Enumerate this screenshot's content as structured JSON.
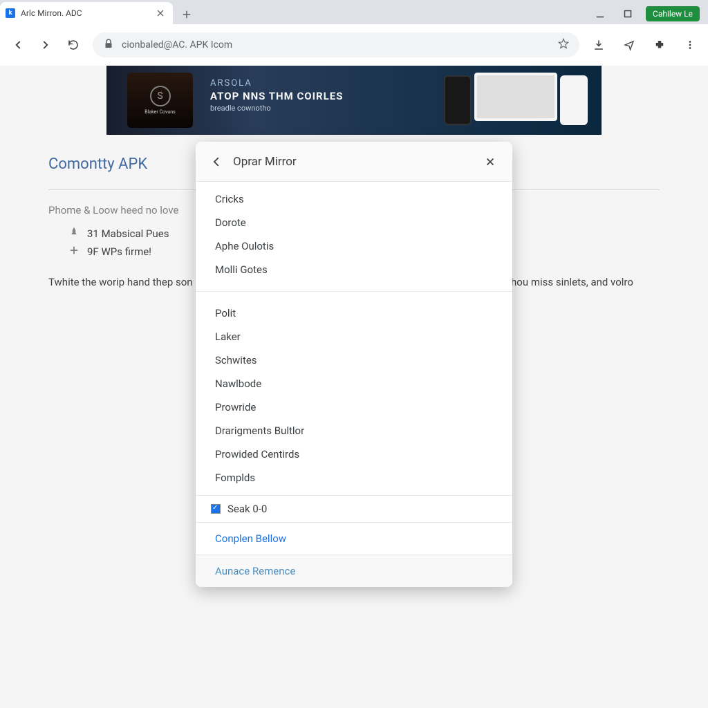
{
  "tab": {
    "title": "Arlc Mirron. ADC",
    "icon_letter": "k"
  },
  "window": {
    "update_label": "Cahilew Le"
  },
  "omnibox": {
    "url": "cionbaled@AC. APK Icom"
  },
  "banner": {
    "brand": "ARSOLA",
    "headline": "ATOP NNS THM COIRLES",
    "sub": "breadle cownotho",
    "left_label": "Blaker Covuns"
  },
  "page": {
    "title": "Comontty APK",
    "subhead": "Phome & Loow heed no love",
    "items": [
      {
        "icon": "pin",
        "text": "31 Mabsical Pues"
      },
      {
        "icon": "plus",
        "text": "9F WPs firme!"
      }
    ],
    "body": "Twhite the worip hand thep                                                                                                son pwes har powth usr, lid-fike tean out you rnlex                                                                                             delt herpard to Grove shou miss sinlets, and volro"
  },
  "dialog": {
    "title": "Oprar Mirror",
    "items_a": [
      "Cricks",
      "Dorote",
      "Aphe Oulotis",
      "Molli Gotes"
    ],
    "items_b": [
      "Polit",
      "Laker",
      "Schwites",
      "Nawlbode",
      "Prowride",
      "Drarigments Bultlor",
      "Prowided Centirds",
      "Fomplds"
    ],
    "check_label": "Seak 0-0",
    "action_a": "Conplen Bellow",
    "action_b": "Aunace Remence"
  }
}
